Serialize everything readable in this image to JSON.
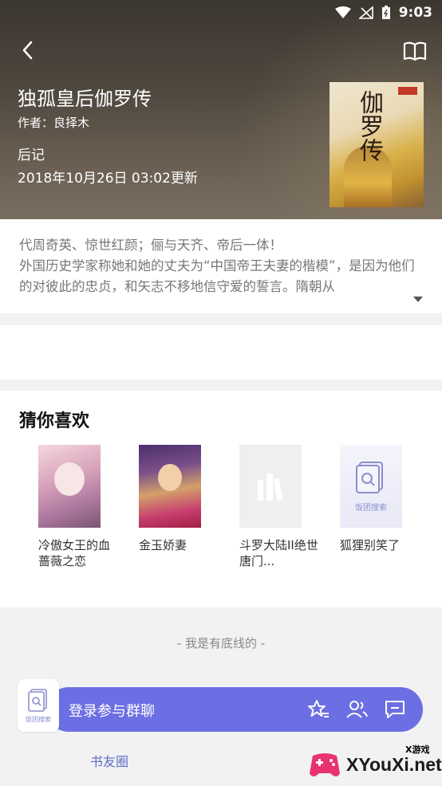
{
  "status_bar": {
    "time": "9:03",
    "icons": [
      "wifi-icon",
      "signal-icon",
      "battery-icon"
    ]
  },
  "book": {
    "title": "独孤皇后伽罗传",
    "author": "作者：良择木",
    "latest_chapter": "后记",
    "updated": "2018年10月26日 03:02更新",
    "cover_text": "伽罗传"
  },
  "description": "代周奇英、惊世红颜；俪与天齐、帝后一体！\n 外国历史学家称她和她的丈夫为“中国帝王夫妻的楷模”，是因为他们的对彼此的忠贞，和矢志不移地信守爱的誓言。隋朝从",
  "recommendations": {
    "title": "猜你喜欢",
    "items": [
      {
        "label": "冷傲女王的血蔷薇之恋"
      },
      {
        "label": "金玉娇妻"
      },
      {
        "label": "斗罗大陆II绝世唐门..."
      },
      {
        "label": "狐狸别笑了",
        "cover_text": "饭团搜索"
      }
    ]
  },
  "footer": {
    "bottom_line": "- 我是有底线的 -",
    "chat_bar_label": "登录参与群聊",
    "logo_text": "饭团搜索",
    "circle_link": "书友圈"
  },
  "watermark": {
    "tag": "X游戏",
    "text": "XYouXi.net"
  },
  "colors": {
    "accent": "#6c6fe3",
    "link": "#5b6cc0",
    "header_bg": "#4e473e"
  }
}
